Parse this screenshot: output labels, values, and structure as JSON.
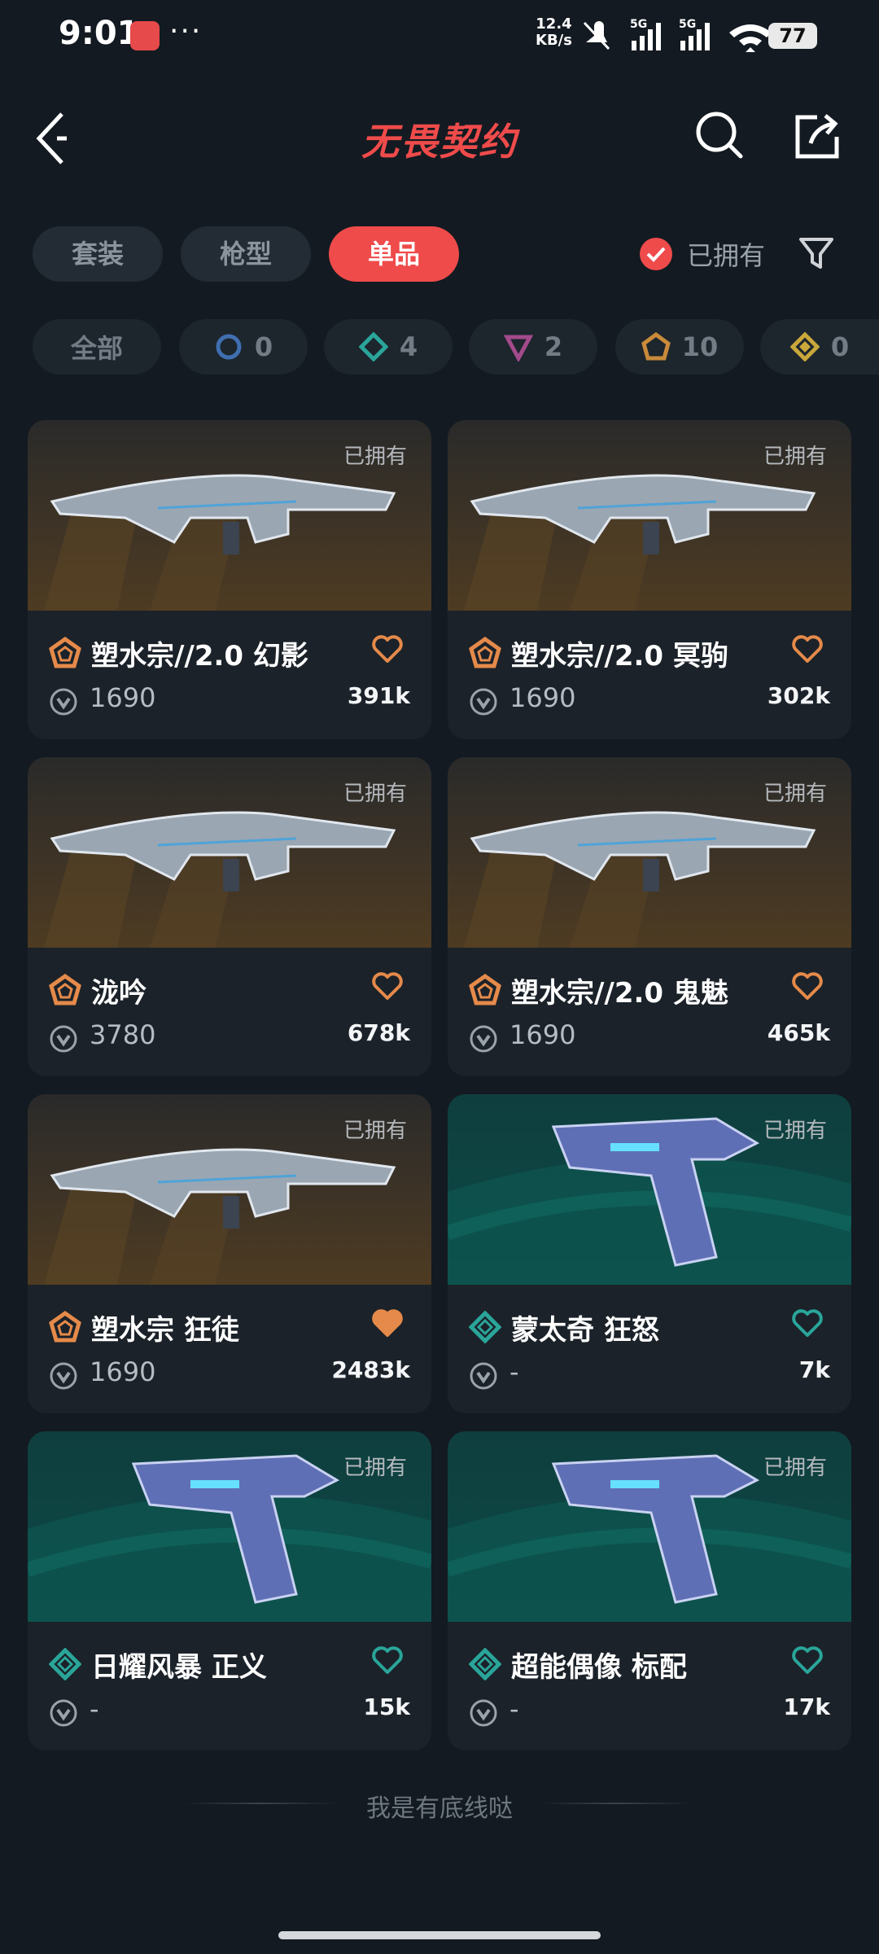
{
  "status": {
    "time": "9:01",
    "net_speed": "12.4\nKB/s",
    "net_speed_top": "12.4",
    "net_speed_bottom": "KB/s",
    "sig1": "5G",
    "sig2": "5G",
    "battery": "77"
  },
  "header": {
    "title": "无畏契约"
  },
  "tabs": [
    {
      "label": "套装"
    },
    {
      "label": "枪型"
    },
    {
      "label": "单品",
      "active": true
    }
  ],
  "owned_filter": {
    "label": "已拥有",
    "checked": true
  },
  "rarity_chips": [
    {
      "label": "全部"
    },
    {
      "count": "0",
      "color": "#3f6fb0",
      "shape": "circle"
    },
    {
      "count": "4",
      "color": "#2aa59a",
      "shape": "diamond"
    },
    {
      "count": "2",
      "color": "#a34a8c",
      "shape": "triangle"
    },
    {
      "count": "10",
      "color": "#c98a3a",
      "shape": "pentagon"
    },
    {
      "count": "0",
      "color": "#c9a73a",
      "shape": "diamond"
    }
  ],
  "items": [
    {
      "name": "塑水宗//2.0 幻影",
      "price": "1690",
      "likes": "391k",
      "owned_tag": "已拥有",
      "tier": "orange",
      "bg": "brown",
      "favorited": false
    },
    {
      "name": "塑水宗//2.0 冥驹",
      "price": "1690",
      "likes": "302k",
      "owned_tag": "已拥有",
      "tier": "orange",
      "bg": "brown",
      "favorited": false
    },
    {
      "name": "泷吟",
      "price": "3780",
      "likes": "678k",
      "owned_tag": "已拥有",
      "tier": "orange",
      "bg": "brown",
      "favorited": false
    },
    {
      "name": "塑水宗//2.0 鬼魅",
      "price": "1690",
      "likes": "465k",
      "owned_tag": "已拥有",
      "tier": "orange",
      "bg": "brown",
      "favorited": false
    },
    {
      "name": "塑水宗 狂徒",
      "price": "1690",
      "likes": "2483k",
      "owned_tag": "已拥有",
      "tier": "orange",
      "bg": "brown",
      "favorited": true
    },
    {
      "name": "蒙太奇 狂怒",
      "price": "-",
      "likes": "7k",
      "owned_tag": "已拥有",
      "tier": "teal",
      "bg": "teal",
      "favorited": false
    },
    {
      "name": "日耀风暴 正义",
      "price": "-",
      "likes": "15k",
      "owned_tag": "已拥有",
      "tier": "teal",
      "bg": "teal",
      "favorited": false
    },
    {
      "name": "超能偶像 标配",
      "price": "-",
      "likes": "17k",
      "owned_tag": "已拥有",
      "tier": "teal",
      "bg": "teal",
      "favorited": false
    }
  ],
  "footer": {
    "text": "我是有底线哒"
  },
  "colors": {
    "accent": "#ef4b4b",
    "orange_tier": "#e58a4a",
    "teal_tier": "#2aa59a"
  }
}
